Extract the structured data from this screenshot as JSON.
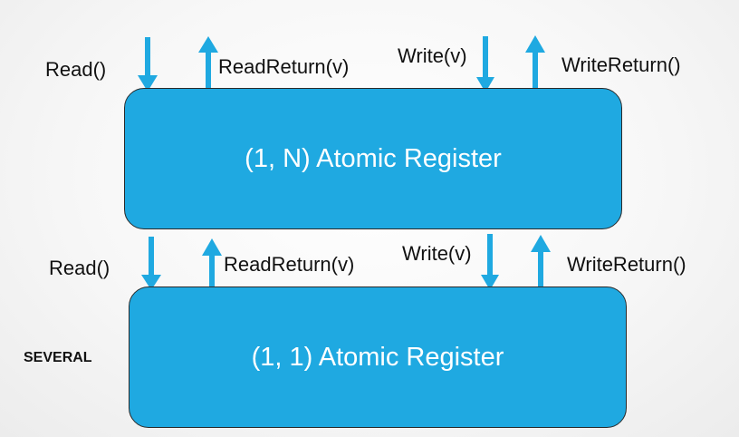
{
  "top_register": {
    "title": "(1, N) Atomic Register",
    "read_label": "Read()",
    "read_return_label": "ReadReturn(v)",
    "write_label": "Write(v)",
    "write_return_label": "WriteReturn()"
  },
  "bottom_register": {
    "title": "(1, 1) Atomic Register",
    "read_label": "Read()",
    "read_return_label": "ReadReturn(v)",
    "write_label": "Write(v)",
    "write_return_label": "WriteReturn()",
    "multiplicity_label": "SEVERAL"
  },
  "colors": {
    "box_fill": "#1fa9e1",
    "arrow": "#1fa9e1",
    "box_text": "#ffffff",
    "label_text": "#111111"
  }
}
